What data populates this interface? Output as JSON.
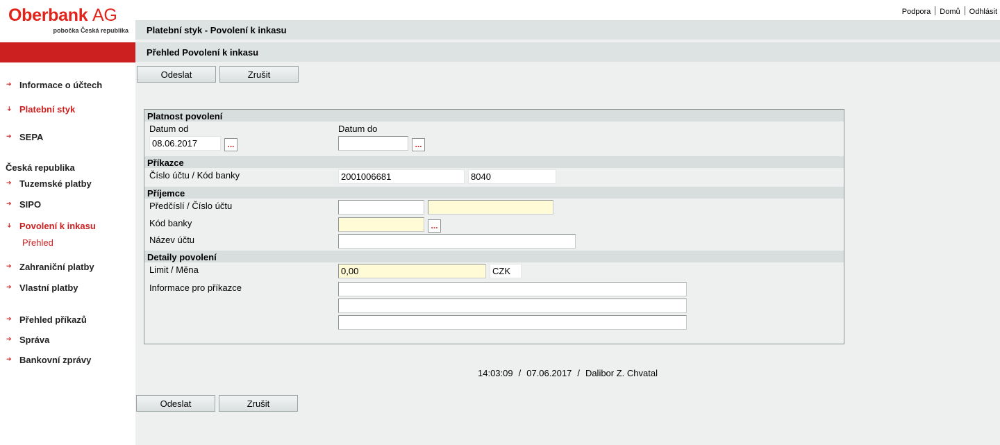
{
  "brand": {
    "name": "Oberbank",
    "suffix": "AG",
    "subtitle": "pobočka Česká republika"
  },
  "toplinks": [
    "Podpora",
    "Domů",
    "Odhlásit"
  ],
  "sidebar": {
    "items": [
      {
        "label": "Informace o účtech"
      },
      {
        "label": "Platební styk"
      },
      {
        "label": "SEPA"
      },
      {
        "heading": "Česká republika"
      },
      {
        "label": "Tuzemské platby"
      },
      {
        "label": "SIPO"
      },
      {
        "label": "Povolení k inkasu"
      },
      {
        "sub": "Přehled"
      },
      {
        "label": "Zahraniční platby"
      },
      {
        "label": "Vlastní platby"
      },
      {
        "label": "Přehled příkazů"
      },
      {
        "label": "Správa"
      },
      {
        "label": "Bankovní zprávy"
      }
    ]
  },
  "header": {
    "title": "Platební styk - Povolení k inkasu",
    "subtitle": "Přehled Povolení k inkasu"
  },
  "buttons": {
    "send": "Odeslat",
    "cancel": "Zrušit"
  },
  "form": {
    "validity": {
      "section": "Platnost povolení",
      "from_label": "Datum od",
      "from_value": "08.06.2017",
      "to_label": "Datum do",
      "to_value": "",
      "picker": "..."
    },
    "payer": {
      "section": "Příkazce",
      "account_label": "Číslo účtu / Kód banky",
      "account_value": "2001006681",
      "bank_code_value": "8040"
    },
    "payee": {
      "section": "Příjemce",
      "account_label": "Předčíslí / Číslo účtu",
      "prefix_value": "",
      "account_value": "",
      "bank_code_label": "Kód banky",
      "bank_code_value": "",
      "name_label": "Název účtu",
      "name_value": ""
    },
    "details": {
      "section": "Detaily povolení",
      "limit_label": "Limit / Měna",
      "limit_value": "0,00",
      "currency_value": "CZK",
      "info_label": "Informace pro příkazce",
      "info_lines": [
        "",
        "",
        ""
      ]
    }
  },
  "status": {
    "time": "14:03:09",
    "date": "07.06.2017",
    "user": "Dalibor Z. Chvatal",
    "separator": "/"
  },
  "colors": {
    "brand_red": "#cc1f1f",
    "required_field": "#fffbd6",
    "panel_bg": "#eef0f0",
    "bar_bg": "#dde2e2"
  }
}
